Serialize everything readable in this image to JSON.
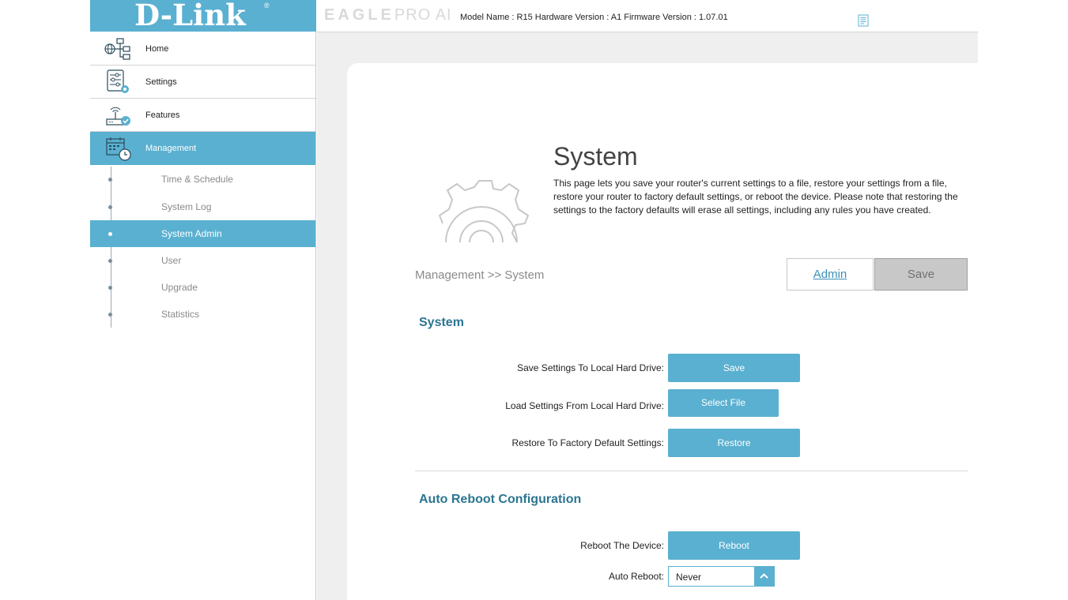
{
  "header": {
    "brand": "D-Link",
    "brand_mark": "®",
    "eagle": "EAGLE",
    "pro_ai": "PRO AI",
    "model_info": "Model Name : R15 Hardware Version : A1 Firmware Version : 1.07.01"
  },
  "sidebar": {
    "items": [
      {
        "label": "Home",
        "icon": "home-network-icon"
      },
      {
        "label": "Settings",
        "icon": "settings-sliders-icon"
      },
      {
        "label": "Features",
        "icon": "router-check-icon"
      },
      {
        "label": "Management",
        "icon": "calendar-clock-icon"
      }
    ],
    "sub_items": [
      {
        "label": "Time & Schedule"
      },
      {
        "label": "System Log"
      },
      {
        "label": "System Admin"
      },
      {
        "label": "User"
      },
      {
        "label": "Upgrade"
      },
      {
        "label": "Statistics"
      }
    ]
  },
  "page": {
    "title": "System",
    "description": "This page lets you save your router's current settings to a file, restore your settings from a file, restore your router to factory default settings, or reboot the device. Please note that restoring the settings to the factory defaults will erase all settings, including any rules you have created.",
    "breadcrumb": "Management >> System",
    "admin_link": "Admin",
    "save_button": "Save"
  },
  "system_section": {
    "title": "System",
    "rows": [
      {
        "label": "Save Settings To Local Hard Drive:",
        "button": "Save"
      },
      {
        "label": "Load Settings From Local Hard Drive:",
        "button": "Select File"
      },
      {
        "label": "Restore To Factory Default Settings:",
        "button": "Restore"
      }
    ]
  },
  "reboot_section": {
    "title": "Auto Reboot Configuration",
    "reboot_label": "Reboot The Device:",
    "reboot_button": "Reboot",
    "auto_reboot_label": "Auto Reboot:",
    "auto_reboot_value": "Never"
  },
  "colors": {
    "accent": "#5ab0d0",
    "section_title": "#2b7591"
  }
}
